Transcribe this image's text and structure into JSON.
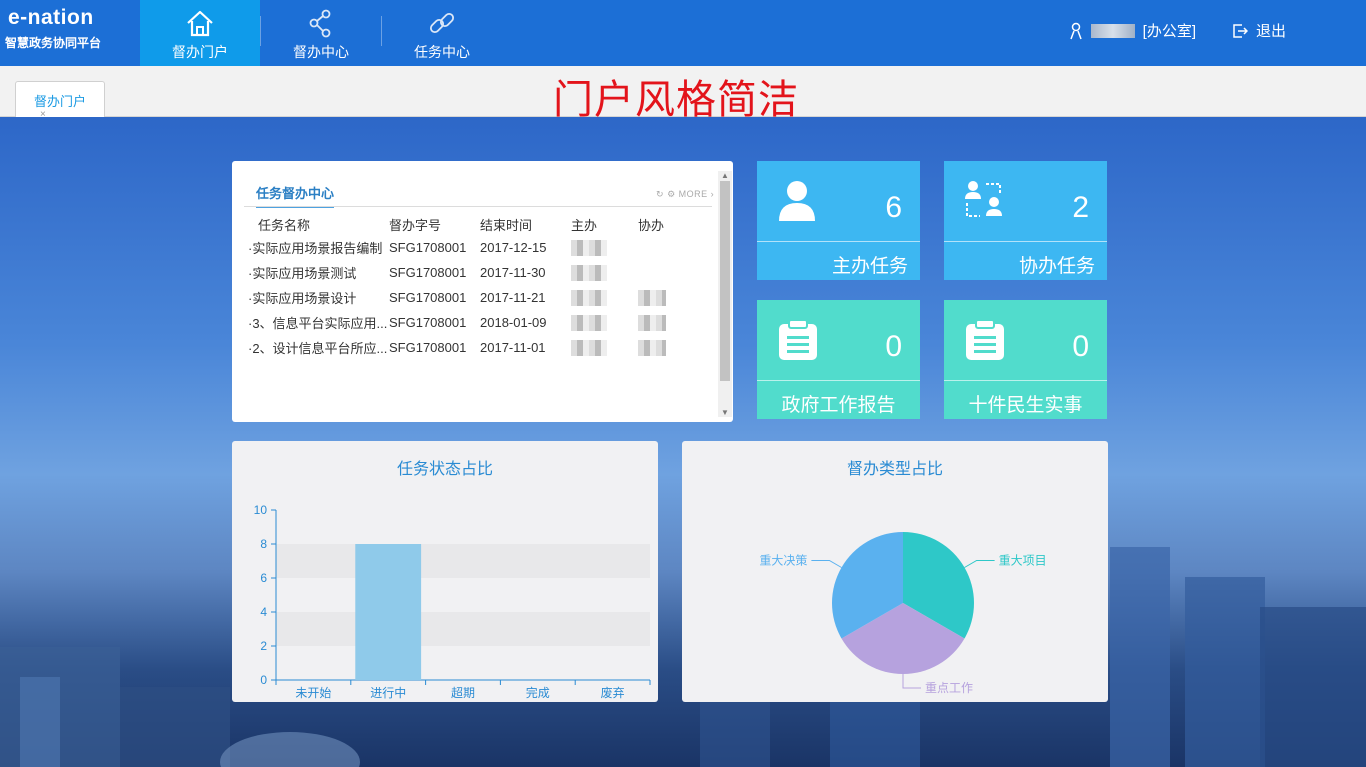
{
  "header": {
    "brand_title": "e-nation",
    "brand_subtitle": "智慧政务协同平台",
    "nav": [
      {
        "label": "督办门户",
        "icon": "home-icon",
        "active": true
      },
      {
        "label": "督办中心",
        "icon": "share-icon",
        "active": false
      },
      {
        "label": "任务中心",
        "icon": "link-icon",
        "active": false
      }
    ],
    "user_name": "[办公室]",
    "logout_label": "退出"
  },
  "tabs": [
    {
      "label": "督办门户",
      "close": "×"
    }
  ],
  "banner": "门户风格简洁",
  "task_panel": {
    "title": "任务督办中心",
    "more": "MORE",
    "columns": [
      "任务名称",
      "督办字号",
      "结束时间",
      "主办",
      "协办"
    ],
    "rows": [
      {
        "name": "·实际应用场景报告编制",
        "code": "SFG1708001",
        "end": "2017-12-15",
        "host": true,
        "assist": false
      },
      {
        "name": "·实际应用场景测试",
        "code": "SFG1708001",
        "end": "2017-11-30",
        "host": true,
        "assist": false
      },
      {
        "name": "·实际应用场景设计",
        "code": "SFG1708001",
        "end": "2017-11-21",
        "host": true,
        "assist": true
      },
      {
        "name": "·3、信息平台实际应用...",
        "code": "SFG1708001",
        "end": "2018-01-09",
        "host": true,
        "assist": true
      },
      {
        "name": "·2、设计信息平台所应...",
        "code": "SFG1708001",
        "end": "2017-11-01",
        "host": true,
        "assist": true
      }
    ]
  },
  "cards": [
    {
      "label": "主办任务",
      "count": "6",
      "color": "#3db7f2",
      "icon": "user-icon"
    },
    {
      "label": "协办任务",
      "count": "2",
      "color": "#3db7f2",
      "icon": "assist-users-icon"
    },
    {
      "label": "政府工作报告",
      "count": "0",
      "color": "#51dccc",
      "icon": "clipboard-icon"
    },
    {
      "label": "十件民生实事",
      "count": "0",
      "color": "#51dccc",
      "icon": "clipboard-icon"
    }
  ],
  "chart_data": [
    {
      "type": "bar",
      "title": "任务状态占比",
      "categories": [
        "未开始",
        "进行中",
        "超期",
        "完成",
        "废弃"
      ],
      "values": [
        0,
        8,
        0,
        0,
        0
      ],
      "ylim": [
        0,
        10
      ],
      "yticks": [
        0,
        2,
        4,
        6,
        8,
        10
      ],
      "bar_color": "#8fcaea",
      "axis_color": "#2a8bd3"
    },
    {
      "type": "pie",
      "title": "督办类型占比",
      "labels": [
        "重大项目",
        "重点工作",
        "重大决策"
      ],
      "values": [
        1,
        1,
        1
      ],
      "colors": [
        "#2ec8c8",
        "#b6a2de",
        "#5ab1ef"
      ]
    }
  ]
}
